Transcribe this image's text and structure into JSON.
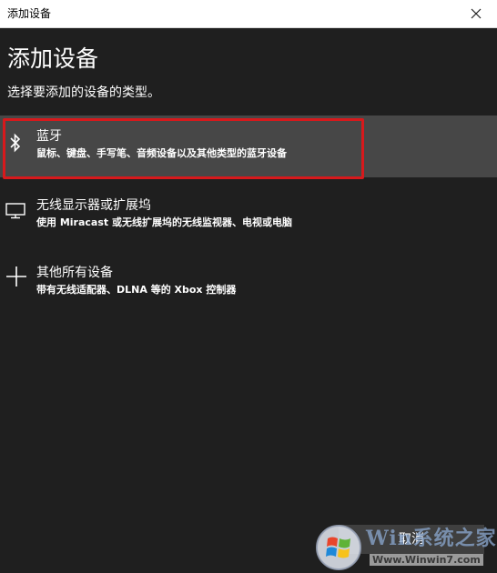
{
  "window": {
    "title": "添加设备",
    "close_icon": "close-icon"
  },
  "page": {
    "heading": "添加设备",
    "subtitle": "选择要添加的设备的类型。"
  },
  "options": [
    {
      "icon": "bluetooth-icon",
      "name": "蓝牙",
      "desc": "鼠标、键盘、手写笔、音频设备以及其他类型的蓝牙设备",
      "selected": true
    },
    {
      "icon": "monitor-icon",
      "name": "无线显示器或扩展坞",
      "desc": "使用 Miracast 或无线扩展坞的无线监视器、电视或电脑",
      "selected": false
    },
    {
      "icon": "plus-icon",
      "name": "其他所有设备",
      "desc": "带有无线适配器、DLNA 等的 Xbox 控制器",
      "selected": false
    }
  ],
  "footer": {
    "cancel_label": "取消"
  },
  "watermark": {
    "logo": "windows-logo",
    "brand": "Win系统之家",
    "url": "Www.Winwin7.com"
  },
  "colors": {
    "background": "#1f1f1f",
    "selected_row": "#474747",
    "highlight_border": "#d7191c",
    "titlebar": "#ffffff"
  }
}
